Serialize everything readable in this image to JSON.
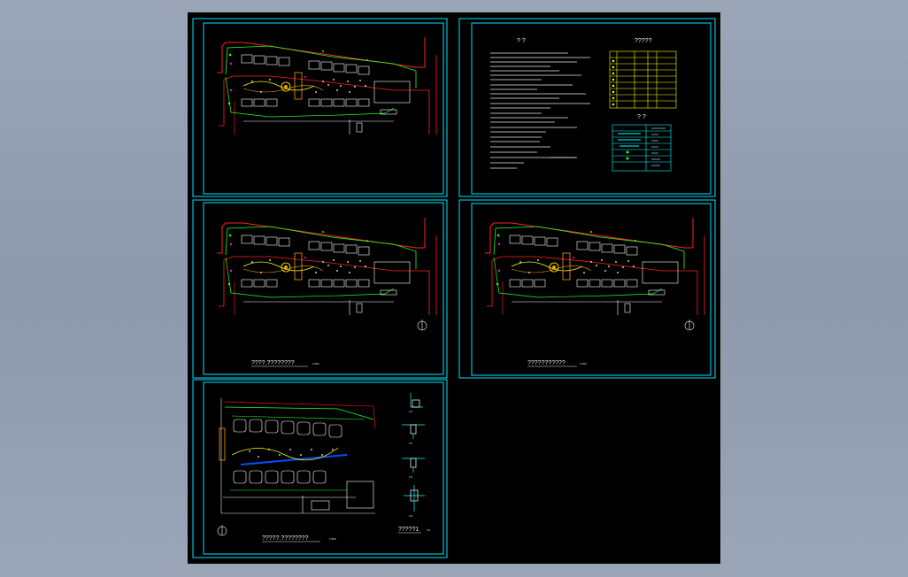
{
  "sheets": [
    {
      "id": "plan-1",
      "title": ""
    },
    {
      "id": "notes",
      "heading": "?    ?",
      "table_title": "?????",
      "legend_title": "?    ?"
    },
    {
      "id": "plan-2",
      "title": "????.????????",
      "scale": "1:500"
    },
    {
      "id": "plan-3",
      "title": "???????????",
      "scale": "1:500"
    },
    {
      "id": "plan-4",
      "title": "?????.????????",
      "scale": "1:500",
      "details_title": "?????1",
      "details_scale": "1:5"
    }
  ],
  "detail_labels": [
    "1:5",
    "1:5",
    "1:5",
    "1:5"
  ],
  "colors": {
    "frame": "#00e5ff",
    "road": "#ff2020",
    "green": "#20ff20",
    "white": "#ffffff",
    "yellow": "#ffff00",
    "magenta": "#ff00ff",
    "orange": "#ff9900",
    "cyan": "#00ffff"
  }
}
